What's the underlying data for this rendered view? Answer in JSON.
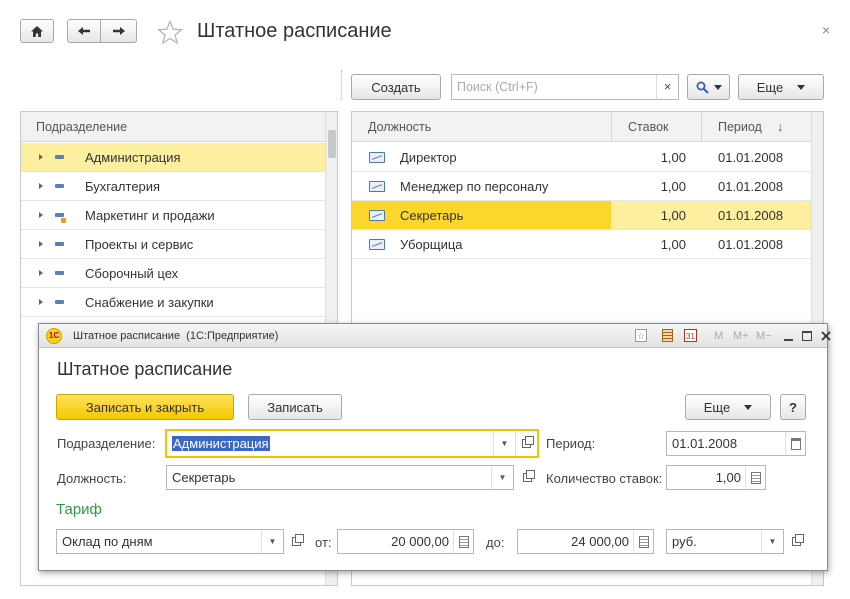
{
  "header": {
    "title": "Штатное расписание",
    "close": "×"
  },
  "toolbar": {
    "create_label": "Создать",
    "search_placeholder": "Поиск (Ctrl+F)",
    "search_clear": "×",
    "more_label": "Еще"
  },
  "left_panel": {
    "column": "Подразделение",
    "items": [
      {
        "label": "Администрация"
      },
      {
        "label": "Бухгалтерия"
      },
      {
        "label": "Маркетинг и продажи"
      },
      {
        "label": "Проекты и сервис"
      },
      {
        "label": "Сборочный цех"
      },
      {
        "label": "Снабжение и закупки"
      }
    ]
  },
  "right_panel": {
    "columns": [
      "Должность",
      "Ставок",
      "Период",
      "↓"
    ],
    "rows": [
      {
        "position": "Директор",
        "rate": "1,00",
        "period": "01.01.2008"
      },
      {
        "position": "Менеджер по персоналу",
        "rate": "1,00",
        "period": "01.01.2008"
      },
      {
        "position": "Секретарь",
        "rate": "1,00",
        "period": "01.01.2008"
      },
      {
        "position": "Уборщица",
        "rate": "1,00",
        "period": "01.01.2008"
      }
    ]
  },
  "dialog": {
    "window_title": "Штатное расписание  (1С:Предприятие)",
    "logo_text": "1С",
    "tb_m": "M",
    "tb_mplus": "M+",
    "tb_mminus": "M−",
    "heading": "Штатное расписание",
    "save_close_label": "Записать и закрыть",
    "save_label": "Записать",
    "more_label": "Еще",
    "help_label": "?",
    "dept_label": "Подразделение:",
    "dept_value": "Администрация",
    "position_label": "Должность:",
    "position_value": "Секретарь",
    "period_label": "Период:",
    "period_value": "01.01.2008",
    "rate_count_label": "Количество ставок:",
    "rate_count_value": "1,00",
    "tariff_heading": "Тариф",
    "tariff_type_value": "Оклад по дням",
    "from_label": "от:",
    "from_value": "20 000,00",
    "to_label": "до:",
    "to_value": "24 000,00",
    "currency_value": "руб."
  },
  "colors": {
    "accent_yellow": "#fad72a",
    "selection_light": "#fcef9f",
    "tariff_green": "#2e9a45"
  }
}
